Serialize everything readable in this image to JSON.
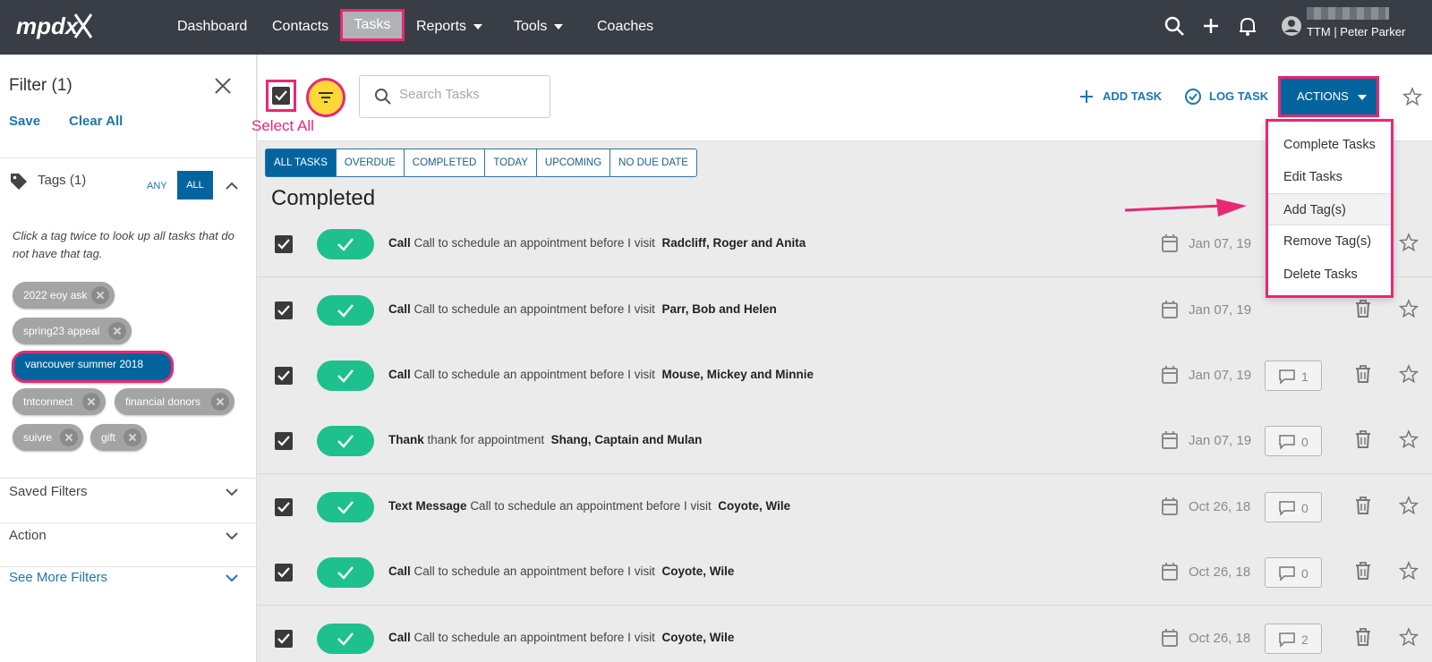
{
  "nav": {
    "logo_text": "mpdx",
    "items": [
      "Dashboard",
      "Contacts",
      "Tasks",
      "Reports",
      "Tools",
      "Coaches"
    ],
    "user_name": "TTM | Peter Parker"
  },
  "sidebar": {
    "title": "Filter (1)",
    "save": "Save",
    "clear_all": "Clear All",
    "tags_heading": "Tags (1)",
    "any": "ANY",
    "all": "ALL",
    "hint": "Click a tag twice to look up all tasks that do not have that tag.",
    "tags": [
      "2022 eoy ask",
      "spring23 appeal",
      "vancouver summer 2018",
      "tntconnect",
      "financial donors",
      "suivre",
      "gift"
    ],
    "active_tag": "vancouver summer 2018",
    "sections": [
      "Saved Filters",
      "Action",
      "See More Filters"
    ]
  },
  "toolbar": {
    "select_all_annotation": "Select All",
    "search_placeholder": "Search Tasks",
    "add_task": "ADD TASK",
    "log_task": "LOG TASK",
    "actions": "ACTIONS"
  },
  "tabs": [
    "ALL TASKS",
    "OVERDUE",
    "COMPLETED",
    "TODAY",
    "UPCOMING",
    "NO DUE DATE"
  ],
  "active_tab": "ALL TASKS",
  "section_title": "Completed",
  "tasks": [
    {
      "type": "Call",
      "desc": "Call to schedule an appointment before I visit",
      "contact": "Radcliff, Roger and Anita",
      "date": "Jan 07, 19",
      "comments": ""
    },
    {
      "type": "Call",
      "desc": "Call to schedule an appointment before I visit",
      "contact": "Parr, Bob and Helen",
      "date": "Jan 07, 19",
      "comments": ""
    },
    {
      "type": "Call",
      "desc": "Call to schedule an appointment before I visit",
      "contact": "Mouse, Mickey and Minnie",
      "date": "Jan 07, 19",
      "comments": "1"
    },
    {
      "type": "Thank",
      "desc": "thank for appointment",
      "contact": "Shang, Captain and Mulan",
      "date": "Jan 07, 19",
      "comments": "0"
    },
    {
      "type": "Text Message",
      "desc": "Call to schedule an appointment before I visit",
      "contact": "Coyote, Wile",
      "date": "Oct 26, 18",
      "comments": "0"
    },
    {
      "type": "Call",
      "desc": "Call to schedule an appointment before I visit",
      "contact": "Coyote, Wile",
      "date": "Oct 26, 18",
      "comments": "0"
    },
    {
      "type": "Call",
      "desc": "Call to schedule an appointment before I visit",
      "contact": "Coyote, Wile",
      "date": "Oct 26, 18",
      "comments": "2"
    }
  ],
  "actions_menu": [
    "Complete Tasks",
    "Edit Tasks",
    "Add Tag(s)",
    "Remove Tag(s)",
    "Delete Tasks"
  ],
  "highlighted_menu_item": "Add Tag(s)",
  "colors": {
    "nav_bg": "#393d45",
    "primary": "#04659e",
    "link": "#1c77b0",
    "annotation": "#e72874",
    "done": "#1ec18e",
    "filter_button": "#fdd838"
  }
}
